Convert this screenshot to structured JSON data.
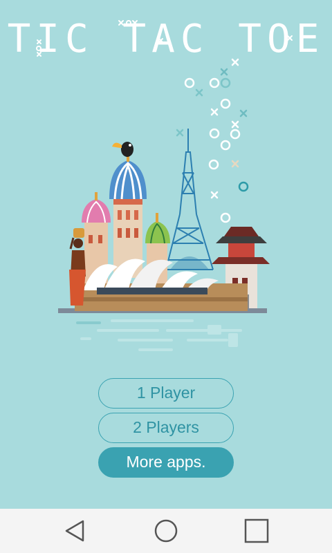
{
  "app": {
    "title": "TIC TAC TOE"
  },
  "menu": {
    "one_player": "1 Player",
    "two_players": "2 Players",
    "more_apps": "More apps."
  },
  "colors": {
    "background": "#a8dbdd",
    "accent": "#3aa2b1",
    "navbar": "#f4f4f4"
  },
  "icons": {
    "back": "back-triangle-icon",
    "home": "home-circle-icon",
    "recent": "recent-square-icon"
  }
}
